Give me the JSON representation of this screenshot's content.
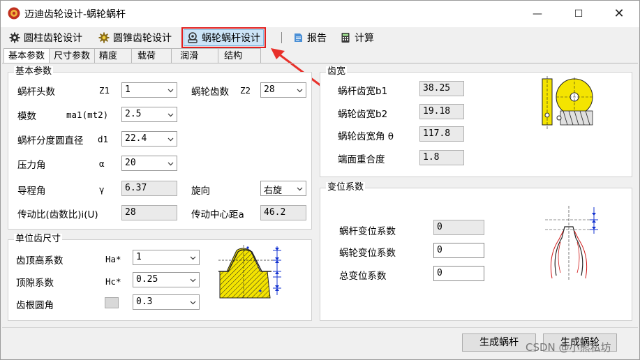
{
  "window": {
    "title": "迈迪齿轮设计-蜗轮蜗杆",
    "minimize": "—",
    "maximize": "☐",
    "close": "✕"
  },
  "toolbar": {
    "items": [
      {
        "label": "圆柱齿轮设计",
        "icon": "gear-icon"
      },
      {
        "label": "圆锥齿轮设计",
        "icon": "bevel-gear-icon"
      },
      {
        "label": "蜗轮蜗杆设计",
        "icon": "worm-gear-icon"
      },
      {
        "label": "报告",
        "icon": "report-icon"
      },
      {
        "label": "计算",
        "icon": "calculator-icon"
      }
    ]
  },
  "tabs": [
    "基本参数",
    "尺寸参数",
    "精度",
    "载荷",
    "润滑",
    "结构"
  ],
  "basic": {
    "title": "基本参数",
    "worm_heads_label": "蜗杆头数",
    "worm_heads_sym": "Z1",
    "worm_heads": "1",
    "wheel_teeth_label": "蜗轮齿数",
    "wheel_teeth_sym": "Z2",
    "wheel_teeth": "28",
    "module_label": "模数",
    "module_sym": "ma1(mt2)",
    "module": "2.5",
    "pitch_dia_label": "蜗杆分度圆直径",
    "pitch_dia_sym": "d1",
    "pitch_dia": "22.4",
    "pressure_label": "压力角",
    "pressure_sym": "α",
    "pressure": "20",
    "lead_label": "导程角",
    "lead_sym": "γ",
    "lead": "6.37",
    "hand_label": "旋向",
    "hand": "右旋",
    "ratio_label": "传动比(齿数比)i(U)",
    "ratio": "28",
    "center_label": "传动中心距a",
    "center": "46.2"
  },
  "unit": {
    "title": "单位齿尺寸",
    "addendum_label": "齿顶高系数",
    "addendum_sym": "Ha*",
    "addendum": "1",
    "clearance_label": "顶隙系数",
    "clearance_sym": "Hc*",
    "clearance": "0.25",
    "fillet_label": "齿根圆角",
    "fillet": "0.3"
  },
  "width": {
    "title": "齿宽",
    "worm_b1_label": "蜗杆齿宽b1",
    "worm_b1": "38.25",
    "wheel_b2_label": "蜗轮齿宽b2",
    "wheel_b2": "19.18",
    "wheel_angle_label": "蜗轮齿宽角 θ",
    "wheel_angle": "117.8",
    "overlap_label": "端面重合度",
    "overlap": "1.8"
  },
  "shift": {
    "title": "变位系数",
    "worm_label": "蜗杆变位系数",
    "worm": "0",
    "wheel_label": "蜗轮变位系数",
    "wheel": "0",
    "total_label": "总变位系数",
    "total": "0"
  },
  "buttons": {
    "gen_worm": "生成蜗杆",
    "gen_wheel": "生成蜗轮"
  },
  "watermark": "CSDN @小熊私坊",
  "colors": {
    "accent_yellow": "#f4e400",
    "highlight_red": "#e02020",
    "dim_blue": "#1030d0"
  }
}
